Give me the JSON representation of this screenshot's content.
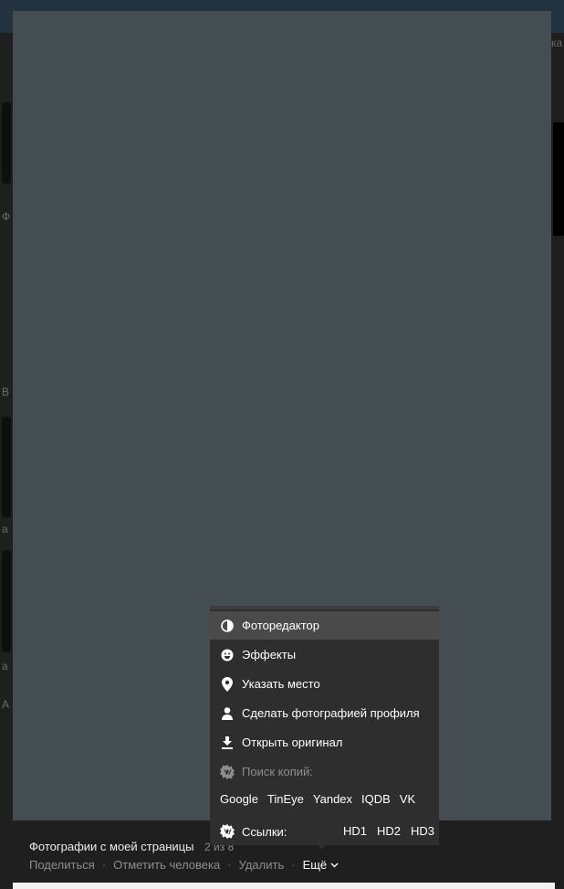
{
  "background": {
    "right_fragment": "ка",
    "left_fragments": [
      "Ф",
      "В",
      "а",
      "а",
      "А"
    ]
  },
  "viewer": {
    "caption": "Фотографии с моей страницы",
    "counter": "2 из 8",
    "actions": {
      "share": "Поделиться",
      "tag": "Отметить человека",
      "delete": "Удалить",
      "more": "Ещё"
    }
  },
  "menu": {
    "items": [
      {
        "label": "Фоторедактор",
        "icon": "contrast-icon"
      },
      {
        "label": "Эффекты",
        "icon": "smile-icon"
      },
      {
        "label": "Указать место",
        "icon": "location-pin-icon"
      },
      {
        "label": "Сделать фотографией профиля",
        "icon": "person-icon"
      },
      {
        "label": "Открыть оригинал",
        "icon": "download-icon"
      }
    ],
    "search_copies_label": "Поиск копий:",
    "engines": [
      "Google",
      "TinEye",
      "Yandex",
      "IQDB",
      "VK"
    ],
    "links_label": "Ссылки:",
    "hd_links": [
      "HD1",
      "HD2",
      "HD3"
    ]
  },
  "colors": {
    "photo_bg": "#434d52",
    "menu_bg": "#2e2e2e",
    "menu_active": "#4a4a4a",
    "footer_bg": "#1f1f1f",
    "topbar": "#23323f"
  }
}
